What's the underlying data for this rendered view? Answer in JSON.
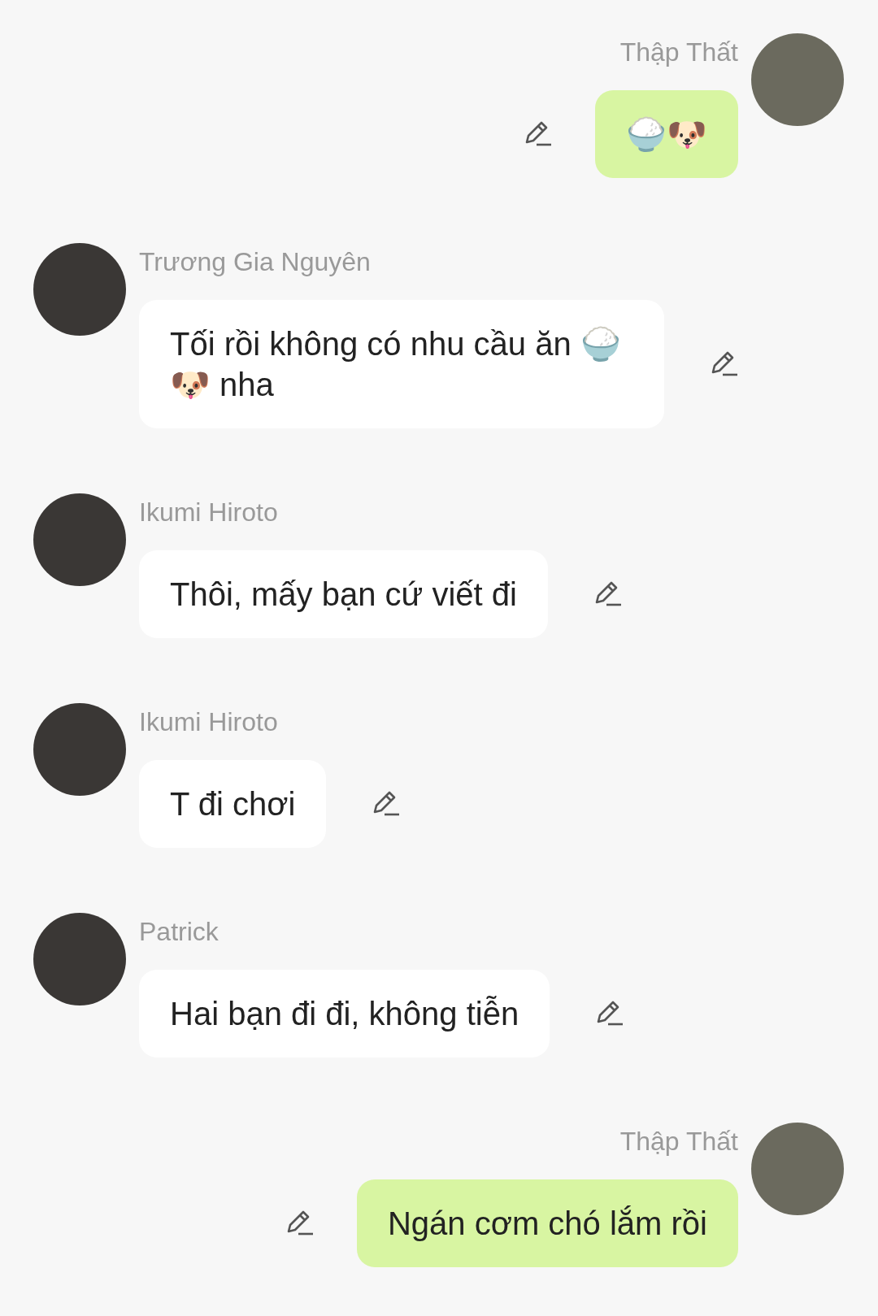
{
  "messages": [
    {
      "kind": "outgoing",
      "sender": "Thập Thất",
      "text": "🍚🐶"
    },
    {
      "kind": "incoming",
      "sender": "Trương Gia Nguyên",
      "text": "Tối rồi không có nhu cầu ăn 🍚🐶 nha"
    },
    {
      "kind": "incoming",
      "sender": "Ikumi Hiroto",
      "text": "Thôi, mấy bạn cứ viết đi"
    },
    {
      "kind": "incoming",
      "sender": "Ikumi Hiroto",
      "text": "T đi chơi"
    },
    {
      "kind": "incoming",
      "sender": "Patrick",
      "text": "Hai bạn đi đi, không tiễn"
    },
    {
      "kind": "outgoing",
      "sender": "Thập Thất",
      "text": "Ngán cơm chó lắm rồi"
    }
  ]
}
